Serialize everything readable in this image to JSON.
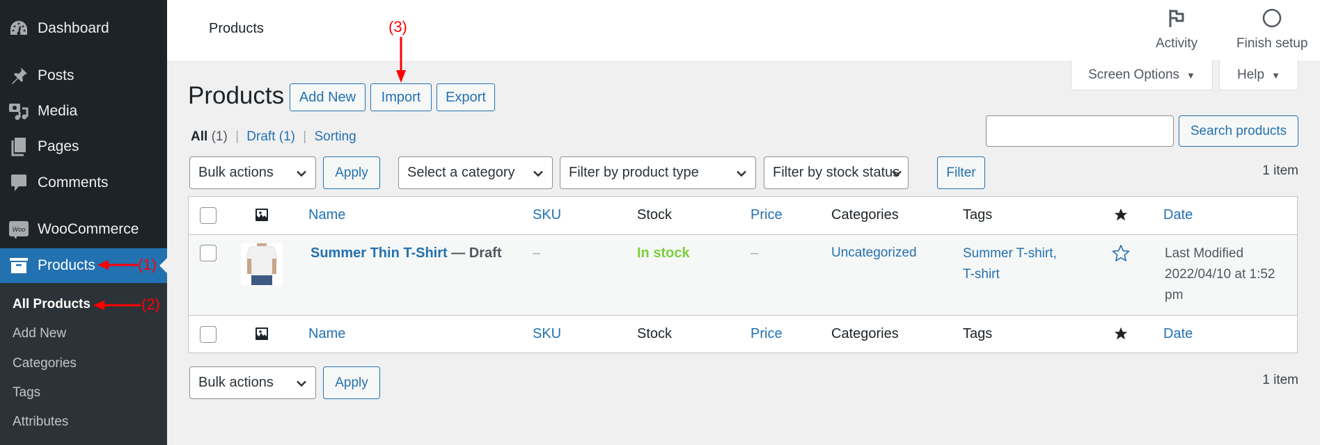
{
  "sidebar": {
    "items": [
      {
        "label": "Dashboard",
        "icon": "dashboard-icon"
      },
      {
        "label": "Posts",
        "icon": "pin-icon"
      },
      {
        "label": "Media",
        "icon": "media-icon"
      },
      {
        "label": "Pages",
        "icon": "pages-icon"
      },
      {
        "label": "Comments",
        "icon": "comment-icon"
      },
      {
        "label": "WooCommerce",
        "icon": "woo-icon",
        "icon_text": "Woo"
      },
      {
        "label": "Products",
        "icon": "archive-icon",
        "active": true
      }
    ],
    "submenu": [
      {
        "label": "All Products",
        "current": true
      },
      {
        "label": "Add New"
      },
      {
        "label": "Categories"
      },
      {
        "label": "Tags"
      },
      {
        "label": "Attributes"
      }
    ]
  },
  "header": {
    "title": "Products",
    "actions": [
      {
        "label": "Activity",
        "icon": "flag-icon"
      },
      {
        "label": "Finish setup",
        "icon": "circle-icon"
      }
    ],
    "screen_options": "Screen Options",
    "help": "Help",
    "dropdown_glyph": "▼"
  },
  "page": {
    "title": "Products",
    "buttons": {
      "add_new": "Add New",
      "import": "Import",
      "export": "Export"
    },
    "views": {
      "all": "All",
      "all_count": "(1)",
      "draft": "Draft",
      "draft_count": "(1)",
      "sorting": "Sorting",
      "separator": "|"
    },
    "search": {
      "value": "",
      "placeholder": "",
      "button": "Search products"
    },
    "filters": {
      "bulk_actions": "Bulk actions",
      "apply": "Apply",
      "category": "Select a category",
      "product_type": "Filter by product type",
      "stock_status": "Filter by stock status",
      "filter": "Filter"
    },
    "item_count": "1 item"
  },
  "table": {
    "columns": {
      "name": "Name",
      "sku": "SKU",
      "stock": "Stock",
      "price": "Price",
      "categories": "Categories",
      "tags": "Tags",
      "date": "Date"
    },
    "rows": [
      {
        "name": "Summer Thin T-Shirt",
        "state": "— Draft",
        "sku": "–",
        "stock": "In stock",
        "price": "–",
        "categories": "Uncategorized",
        "tags": "Summer T-shirt, T-shirt",
        "tag_1": "Summer T-shirt,",
        "tag_2": "T-shirt",
        "featured": false,
        "date_label": "Last Modified",
        "date_value": "2022/04/10 at 1:52 pm"
      }
    ]
  },
  "footer": {
    "bulk_actions": "Bulk actions",
    "apply": "Apply",
    "item_count": "1 item"
  },
  "annotations": {
    "one": "(1)",
    "two": "(2)",
    "three": "(3)",
    "color": "#ff0000"
  },
  "colors": {
    "accent": "#2271b1",
    "sidebar_bg": "#1d2327",
    "in_stock": "#7ad03a"
  }
}
